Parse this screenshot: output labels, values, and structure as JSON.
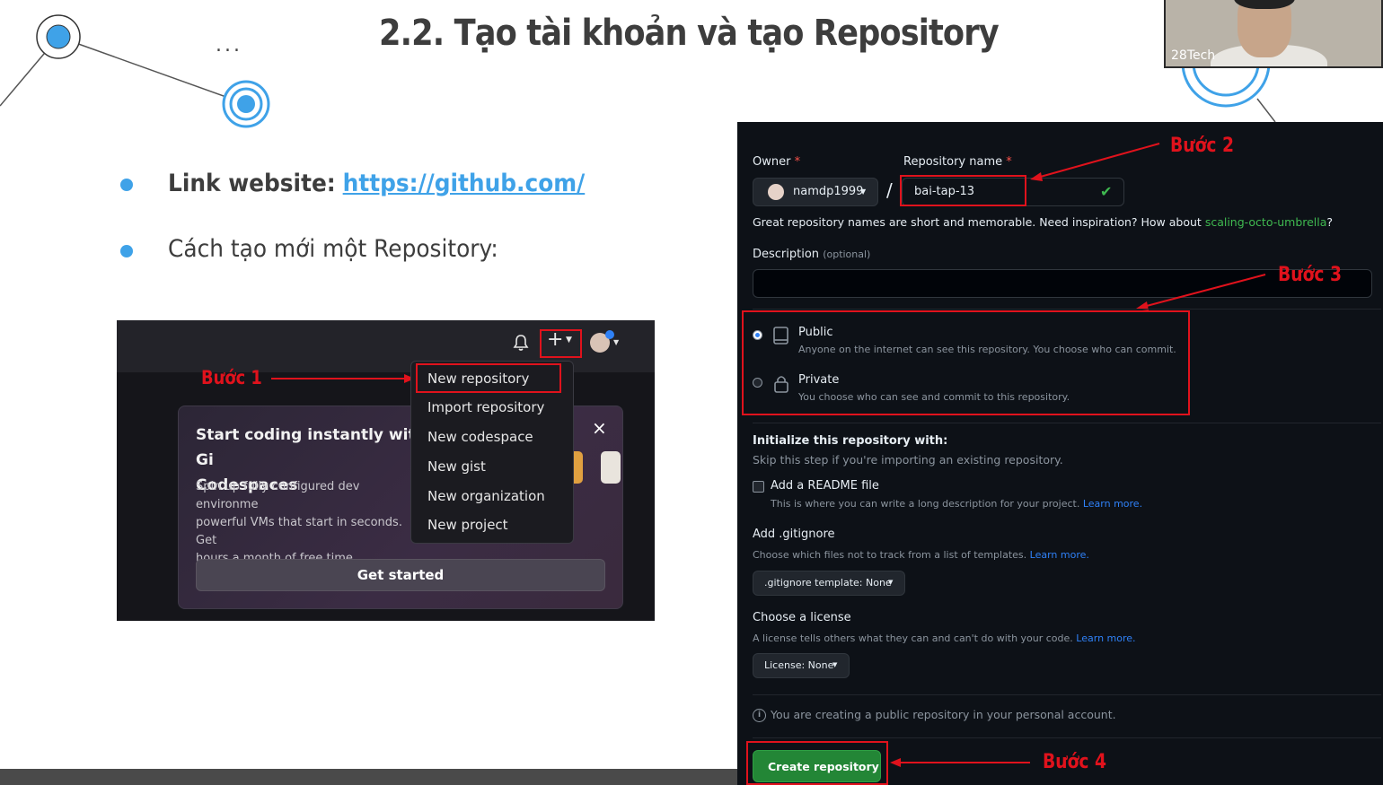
{
  "slide": {
    "title": "2.2. Tạo tài khoản và tạo Repository",
    "dots": "...",
    "bullets": [
      {
        "label": "Link website:",
        "link": "https://github.com/"
      },
      {
        "label": "Cách tạo mới một Repository:"
      }
    ]
  },
  "webcam": {
    "name": "28Tech"
  },
  "steps": {
    "step1": "Bước 1",
    "step2": "Bước 2",
    "step3": "Bước 3",
    "step4": "Bước 4"
  },
  "github_menu": {
    "items": [
      "New repository",
      "Import repository",
      "New codespace",
      "New gist",
      "New organization",
      "New project"
    ],
    "plus_icon": "plus-icon",
    "bell_icon": "bell-icon"
  },
  "codespaces_card": {
    "title_line1": "Start coding instantly with Gi",
    "title_line2": "Codespaces",
    "desc_line1": "Spin up fully configured dev environme",
    "desc_line2": "powerful VMs that start in seconds. Get",
    "desc_line3": "hours a month of free time.",
    "button": "Get started",
    "close": "×"
  },
  "new_repo_form": {
    "owner_label": "Owner",
    "repo_name_label": "Repository name",
    "required_mark": "*",
    "owner_value": "namdp1999",
    "slash": "/",
    "repo_name_value": "bai-tap-13",
    "hint_text": "Great repository names are short and memorable. Need inspiration? How about",
    "suggestion": "scaling-octo-umbrella",
    "suggestion_end": "?",
    "description_label": "Description",
    "description_optional": "(optional)",
    "visibility": [
      {
        "label": "Public",
        "desc": "Anyone on the internet can see this repository. You choose who can commit.",
        "selected": true
      },
      {
        "label": "Private",
        "desc": "You choose who can see and commit to this repository.",
        "selected": false
      }
    ],
    "init_title": "Initialize this repository with:",
    "init_sub": "Skip this step if you're importing an existing repository.",
    "readme_label": "Add a README file",
    "readme_desc": "This is where you can write a long description for your project.",
    "learn_more": "Learn more.",
    "gitignore_title": "Add .gitignore",
    "gitignore_desc": "Choose which files not to track from a list of templates.",
    "gitignore_select": ".gitignore template: None",
    "license_title": "Choose a license",
    "license_desc": "A license tells others what they can and can't do with your code.",
    "license_select": "License: None",
    "info_text": "You are creating a public repository in your personal account.",
    "create_button": "Create repository"
  },
  "colors": {
    "accent": "#3fa2e8",
    "red": "#e0121c",
    "github_green": "#238636",
    "github_bg": "#0d1117"
  }
}
